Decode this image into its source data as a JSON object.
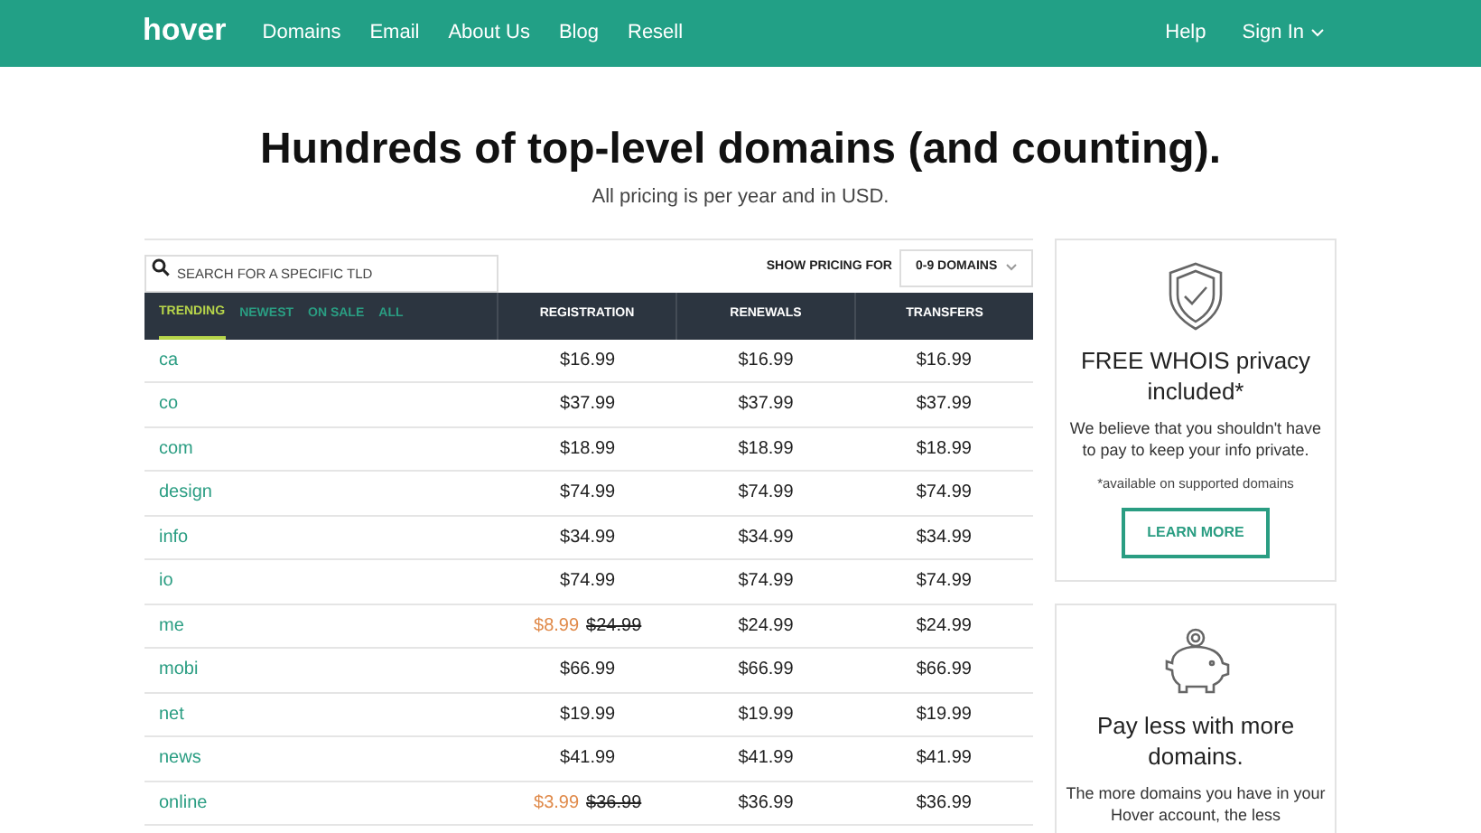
{
  "nav": {
    "logo": "hover",
    "links": [
      "Domains",
      "Email",
      "About Us",
      "Blog",
      "Resell"
    ],
    "right_links": [
      "Help",
      "Sign In"
    ]
  },
  "hero": {
    "title": "Hundreds of top-level domains (and counting).",
    "subtitle": "All pricing is per year and in USD."
  },
  "search": {
    "placeholder": "SEARCH FOR A SPECIFIC TLD"
  },
  "pricing_for": {
    "label": "SHOW PRICING FOR",
    "value": "0-9 DOMAINS"
  },
  "tabs": [
    {
      "label": "TRENDING",
      "selected": true
    },
    {
      "label": "NEWEST",
      "selected": false
    },
    {
      "label": "ON SALE",
      "selected": false
    },
    {
      "label": "ALL",
      "selected": false
    }
  ],
  "columns": [
    "REGISTRATION",
    "RENEWALS",
    "TRANSFERS"
  ],
  "rows": [
    {
      "tld": "ca",
      "registration": "$16.99",
      "renewal": "$16.99",
      "transfer": "$16.99"
    },
    {
      "tld": "co",
      "registration": "$37.99",
      "renewal": "$37.99",
      "transfer": "$37.99"
    },
    {
      "tld": "com",
      "registration": "$18.99",
      "renewal": "$18.99",
      "transfer": "$18.99"
    },
    {
      "tld": "design",
      "registration": "$74.99",
      "renewal": "$74.99",
      "transfer": "$74.99"
    },
    {
      "tld": "info",
      "registration": "$34.99",
      "renewal": "$34.99",
      "transfer": "$34.99"
    },
    {
      "tld": "io",
      "registration": "$74.99",
      "renewal": "$74.99",
      "transfer": "$74.99"
    },
    {
      "tld": "me",
      "sale_price": "$8.99",
      "registration": "$24.99",
      "renewal": "$24.99",
      "transfer": "$24.99"
    },
    {
      "tld": "mobi",
      "registration": "$66.99",
      "renewal": "$66.99",
      "transfer": "$66.99"
    },
    {
      "tld": "net",
      "registration": "$19.99",
      "renewal": "$19.99",
      "transfer": "$19.99"
    },
    {
      "tld": "news",
      "registration": "$41.99",
      "renewal": "$41.99",
      "transfer": "$41.99"
    },
    {
      "tld": "online",
      "sale_price": "$3.99",
      "registration": "$36.99",
      "renewal": "$36.99",
      "transfer": "$36.99"
    }
  ],
  "cards": [
    {
      "kind": "shield",
      "title": "FREE WHOIS privacy included*",
      "text": "We believe that you shouldn't have to pay to keep your info private.",
      "note": "*available on supported domains",
      "button": "LEARN MORE"
    },
    {
      "kind": "piggy",
      "title": "Pay less with more domains.",
      "text": "The more domains you have in your Hover account, the less"
    }
  ]
}
